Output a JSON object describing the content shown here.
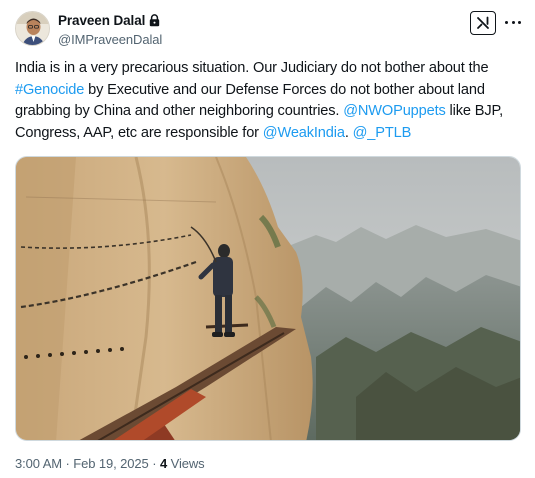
{
  "author": {
    "display_name": "Praveen Dalal",
    "handle": "@IMPraveenDalal",
    "protected_icon": "lock-icon"
  },
  "actions": {
    "grok_icon": "grok-icon",
    "more_icon": "more-icon"
  },
  "tweet": {
    "segments": [
      {
        "text": "India is in a very precarious situation. Our Judiciary do not bother about the ",
        "type": "text"
      },
      {
        "text": "#Genocide",
        "type": "hashtag"
      },
      {
        "text": " by Executive and our Defense Forces do not bother about land grabbing by China and other neighboring countries. ",
        "type": "text"
      },
      {
        "text": "@NWOPuppets",
        "type": "mention"
      },
      {
        "text": " like BJP, Congress, AAP, etc are responsible for ",
        "type": "text"
      },
      {
        "text": "@WeakIndia",
        "type": "mention"
      },
      {
        "text": ". ",
        "type": "text"
      },
      {
        "text": "@_PTLB",
        "type": "mention"
      }
    ]
  },
  "media": {
    "kind": "photo",
    "subject": "person-climbing-cliff-plank-path"
  },
  "meta": {
    "time": "3:00 AM",
    "separator": "·",
    "date": "Feb 19, 2025",
    "views_count": "4",
    "views_label": "Views"
  },
  "colors": {
    "link": "#1d9bf0",
    "text": "#0f1419",
    "secondary": "#536471",
    "border": "#cfd9de"
  }
}
